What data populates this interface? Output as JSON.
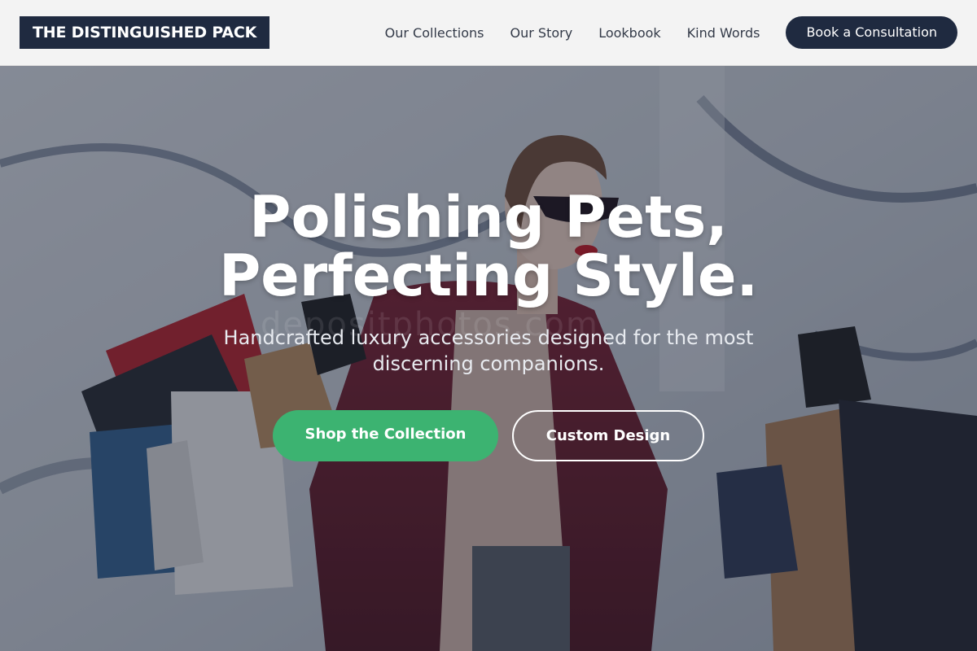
{
  "brand": {
    "logo_text": "THE DISTINGUISHED PACK"
  },
  "nav": {
    "items": [
      {
        "label": "Our Collections"
      },
      {
        "label": "Our Story"
      },
      {
        "label": "Lookbook"
      },
      {
        "label": "Kind Words"
      }
    ],
    "cta_label": "Book a Consultation"
  },
  "hero": {
    "title_line1": "Polishing Pets,",
    "title_line2": "Perfecting Style.",
    "subtitle": "Handcrafted luxury accessories designed for the most discerning companions.",
    "primary_button": "Shop the Collection",
    "secondary_button": "Custom Design",
    "watermark": "depositphotos.com"
  },
  "colors": {
    "brand_navy": "#1f2a40",
    "accent_green": "#3cb371",
    "header_bg": "#f3f3f3"
  }
}
